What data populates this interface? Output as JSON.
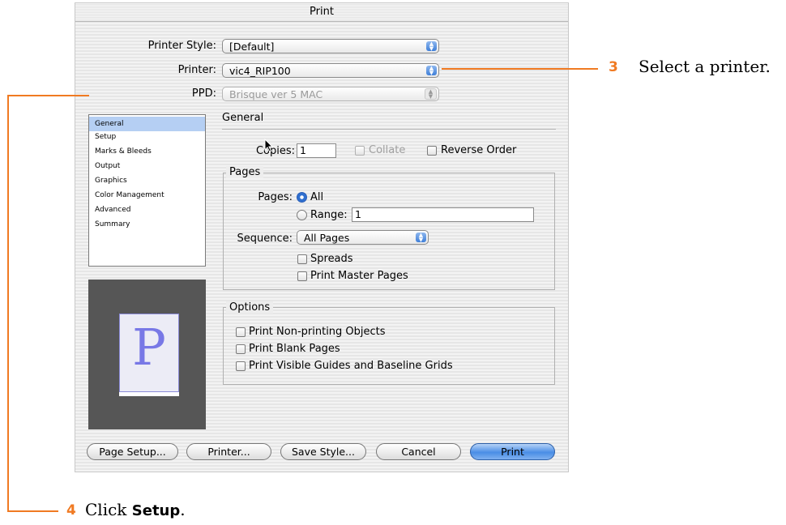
{
  "dialog": {
    "title": "Print",
    "printer_style": {
      "label": "Printer Style:",
      "value": "[Default]"
    },
    "printer": {
      "label": "Printer:",
      "value": "vic4_RIP100"
    },
    "ppd": {
      "label": "PPD:",
      "value": "Brisque ver 5 MAC"
    },
    "sidebar": {
      "items": [
        "General",
        "Setup",
        "Marks & Bleeds",
        "Output",
        "Graphics",
        "Color Management",
        "Advanced",
        "Summary"
      ],
      "selected": "General"
    },
    "preview_letter": "P",
    "section_title": "General",
    "copies": {
      "label": "Copies:",
      "value": "1"
    },
    "collate": {
      "label": "Collate",
      "checked": false,
      "enabled": false
    },
    "reverse_order": {
      "label": "Reverse Order",
      "checked": false
    },
    "pages_group": {
      "title": "Pages",
      "pages_label": "Pages:",
      "all_label": "All",
      "range_label": "Range:",
      "range_value": "1",
      "selected": "All",
      "sequence_label": "Sequence:",
      "sequence_value": "All Pages",
      "spreads_label": "Spreads",
      "print_master_pages_label": "Print Master Pages"
    },
    "options_group": {
      "title": "Options",
      "items": [
        "Print Non-printing Objects",
        "Print Blank Pages",
        "Print Visible Guides and Baseline Grids"
      ]
    },
    "buttons": {
      "page_setup": "Page Setup...",
      "printer": "Printer...",
      "save_style": "Save Style...",
      "cancel": "Cancel",
      "print": "Print"
    }
  },
  "callouts": [
    {
      "number": "3",
      "text": "Select a printer."
    },
    {
      "number": "4",
      "text_prefix": "Click ",
      "text_bold": "Setup",
      "text_suffix": "."
    }
  ],
  "colors": {
    "callout": "#f07a22",
    "selection": "#b5cff3",
    "default_button": "#4a8ee6"
  }
}
